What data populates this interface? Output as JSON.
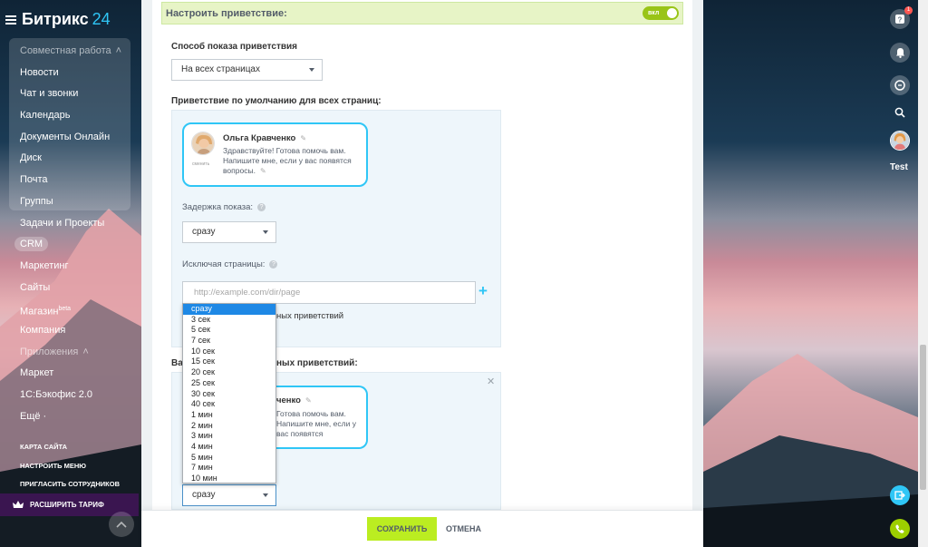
{
  "app": {
    "logo_name": "Битрикс",
    "logo_num": "24"
  },
  "sidebar": {
    "items": [
      {
        "label": "Совместная работа",
        "name": "sidebar-section-collab",
        "section": true
      },
      {
        "label": "Новости",
        "name": "sidebar-item-news"
      },
      {
        "label": "Чат и звонки",
        "name": "sidebar-item-chat"
      },
      {
        "label": "Календарь",
        "name": "sidebar-item-calendar"
      },
      {
        "label": "Документы Онлайн",
        "name": "sidebar-item-docs"
      },
      {
        "label": "Диск",
        "name": "sidebar-item-disk"
      },
      {
        "label": "Почта",
        "name": "sidebar-item-mail"
      },
      {
        "label": "Группы",
        "name": "sidebar-item-groups"
      },
      {
        "label": "Задачи и Проекты",
        "name": "sidebar-item-tasks"
      },
      {
        "label": "CRM",
        "name": "sidebar-item-crm"
      },
      {
        "label": "Маркетинг",
        "name": "sidebar-item-marketing"
      },
      {
        "label": "Сайты",
        "name": "sidebar-item-sites"
      },
      {
        "label": "Магазин",
        "name": "sidebar-item-shop",
        "sup": "beta"
      },
      {
        "label": "Компания",
        "name": "sidebar-item-company"
      },
      {
        "label": "Приложения",
        "name": "sidebar-section-apps",
        "section": true
      },
      {
        "label": "Маркет",
        "name": "sidebar-item-market"
      },
      {
        "label": "1С:Бэкофис 2.0",
        "name": "sidebar-item-1c"
      },
      {
        "label": "Ещё ·",
        "name": "sidebar-item-more"
      }
    ],
    "bottom_links": [
      "КАРТА САЙТА",
      "НАСТРОИТЬ МЕНЮ",
      "ПРИГЛАСИТЬ СОТРУДНИКОВ"
    ],
    "upgrade_label": "РАСШИРИТЬ ТАРИФ"
  },
  "form": {
    "header_title": "Настроить приветствие:",
    "toggle_label": "вкл",
    "toggle_on": true,
    "display_mode_label": "Способ показа приветствия",
    "display_mode_value": "На всех страницах",
    "default_greeting_label": "Приветствие по умолчанию для всех страниц:",
    "operator_name": "Ольга Кравченко",
    "change_label": "сменить",
    "greeting_text": "Здравствуйте! Готова помочь вам. Напишите мне, если у вас появятся вопросы.",
    "greeting_text_second": "Готова помочь вам. Напишите мне, если у вас появятся",
    "delay_label": "Задержка показа:",
    "delay_value": "сразу",
    "exclude_label": "Исключая страницы:",
    "exclude_placeholder": "http://example.com/dir/page",
    "hidden_checkbox_text_tail": "ных приветствий",
    "second_section_label_start": "Ва",
    "second_section_label_end": "ных приветствий:",
    "second_name_fragment": "ченко",
    "second_delay_value": "сразу"
  },
  "dropdown": {
    "options": [
      "сразу",
      "3 сек",
      "5 сек",
      "7 сек",
      "10 сек",
      "15 сек",
      "20 сек",
      "25 сек",
      "30 сек",
      "40 сек",
      "1 мин",
      "2 мин",
      "3 мин",
      "4 мин",
      "5 мин",
      "7 мин",
      "10 мин"
    ],
    "selected_index": 0
  },
  "footer": {
    "save_label": "СОХРАНИТЬ",
    "cancel_label": "ОТМЕНА"
  },
  "rightbar": {
    "help_badge": "1",
    "user_name": "Test"
  },
  "colors": {
    "accent": "#2fc6f6",
    "save": "#bbed21",
    "toggle": "#99c418",
    "selected_option": "#1e88e5"
  }
}
